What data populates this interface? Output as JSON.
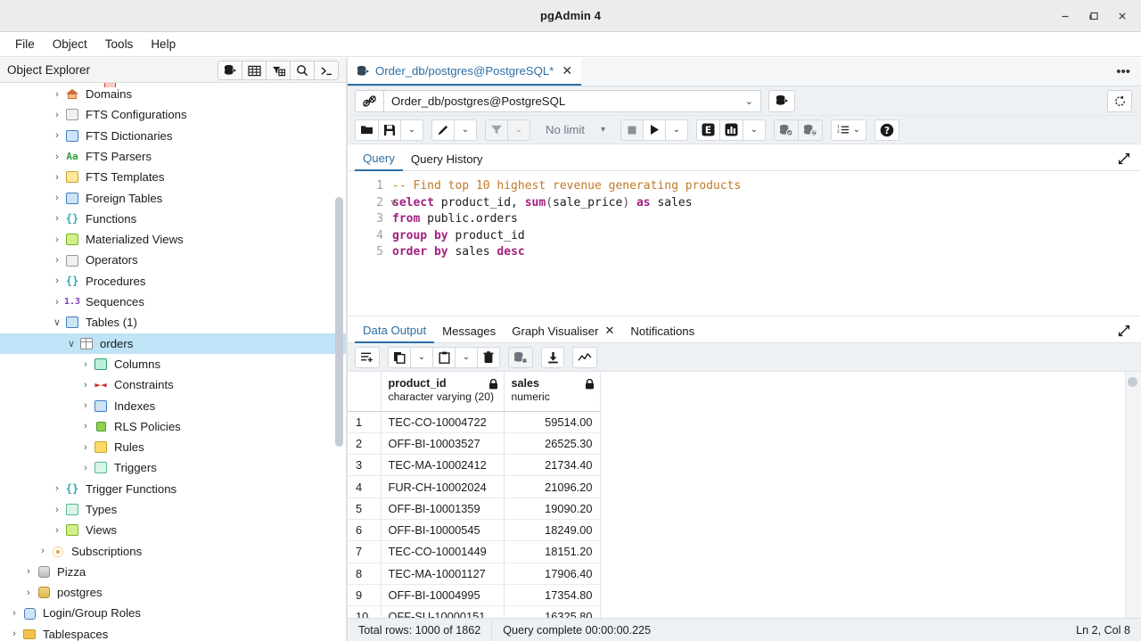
{
  "window": {
    "title": "pgAdmin 4",
    "minimize_label": "–",
    "maximize_label": "❐",
    "close_label": "✕"
  },
  "menubar": {
    "items": [
      {
        "label": "File"
      },
      {
        "label": "Object"
      },
      {
        "label": "Tools"
      },
      {
        "label": "Help"
      }
    ]
  },
  "object_explorer": {
    "title": "Object Explorer",
    "tools": [
      {
        "name": "server-connect-icon"
      },
      {
        "name": "grid-table-icon"
      },
      {
        "name": "filter-table-icon"
      },
      {
        "name": "search-icon"
      },
      {
        "name": "terminal-icon"
      }
    ],
    "tree": [
      {
        "label": "Domains",
        "indent": 5,
        "arrow": "›",
        "icon": "house"
      },
      {
        "label": "FTS Configurations",
        "indent": 5,
        "arrow": "›",
        "icon": "grayp"
      },
      {
        "label": "FTS Dictionaries",
        "indent": 5,
        "arrow": "›",
        "icon": "blue"
      },
      {
        "label": "FTS Parsers",
        "indent": 5,
        "arrow": "›",
        "icon": "aa"
      },
      {
        "label": "FTS Templates",
        "indent": 5,
        "arrow": "›",
        "icon": "yellow"
      },
      {
        "label": "Foreign Tables",
        "indent": 5,
        "arrow": "›",
        "icon": "blue"
      },
      {
        "label": "Functions",
        "indent": 5,
        "arrow": "›",
        "icon": "cyanring"
      },
      {
        "label": "Materialized Views",
        "indent": 5,
        "arrow": "›",
        "icon": "lime"
      },
      {
        "label": "Operators",
        "indent": 5,
        "arrow": "›",
        "icon": "grayp"
      },
      {
        "label": "Procedures",
        "indent": 5,
        "arrow": "›",
        "icon": "cyanring"
      },
      {
        "label": "Sequences",
        "indent": 5,
        "arrow": "›",
        "icon": "num13"
      },
      {
        "label": "Tables (1)",
        "indent": 5,
        "arrow": "∨",
        "icon": "blue"
      },
      {
        "label": "orders",
        "indent": 6,
        "arrow": "∨",
        "icon": "tablewhite",
        "selected": true
      },
      {
        "label": "Columns",
        "indent": 7,
        "arrow": "›",
        "icon": "green"
      },
      {
        "label": "Constraints",
        "indent": 7,
        "arrow": "›",
        "icon": "arrows"
      },
      {
        "label": "Indexes",
        "indent": 7,
        "arrow": "›",
        "icon": "blue"
      },
      {
        "label": "RLS Policies",
        "indent": 7,
        "arrow": "›",
        "icon": "lockg"
      },
      {
        "label": "Rules",
        "indent": 7,
        "arrow": "›",
        "icon": "yellow2"
      },
      {
        "label": "Triggers",
        "indent": 7,
        "arrow": "›",
        "icon": "greenlt"
      },
      {
        "label": "Trigger Functions",
        "indent": 5,
        "arrow": "›",
        "icon": "cyanring"
      },
      {
        "label": "Types",
        "indent": 5,
        "arrow": "›",
        "icon": "greenlt"
      },
      {
        "label": "Views",
        "indent": 5,
        "arrow": "›",
        "icon": "lime"
      },
      {
        "label": "Subscriptions",
        "indent": 4,
        "arrow": "›",
        "icon": "sub"
      },
      {
        "label": "Pizza",
        "indent": 3,
        "arrow": "›",
        "icon": "dbx"
      },
      {
        "label": "postgres",
        "indent": 3,
        "arrow": "›",
        "icon": "db"
      },
      {
        "label": "Login/Group Roles",
        "indent": 2,
        "arrow": "›",
        "icon": "roles"
      },
      {
        "label": "Tablespaces",
        "indent": 2,
        "arrow": "›",
        "icon": "folder"
      }
    ]
  },
  "query_tool": {
    "tab": {
      "label": "Order_db/postgres@PostgreSQL*",
      "close_label": "✕",
      "icon": "database-tab-icon"
    },
    "kebab_label": "more-options",
    "connection": {
      "value": "Order_db/postgres@PostgreSQL",
      "chevron": "⌄",
      "icon": "disconnect-icon",
      "new_connection_icon": "new-connection-icon",
      "reset_icon": "reset-layout-icon"
    },
    "toolbar": {
      "open_file": "folder-open-icon",
      "save_file": "save-icon",
      "save_chevron": "⌄",
      "edit": "pencil-icon",
      "edit_chevron": "⌄",
      "filter": "filter-icon",
      "filter_chevron": "⌄",
      "limit_label": "No limit",
      "limit_chevron": "▾",
      "stop": "stop-icon",
      "execute": "▶",
      "execute_chevron": "⌄",
      "explain": "E",
      "explain_analyze": "chart-bar-icon",
      "explain_chevron": "⌄",
      "commit": "commit-icon",
      "rollback": "rollback-icon",
      "macros": "macros-icon",
      "macros_chevron": "⌄",
      "help": "?"
    },
    "editor_tabs": [
      {
        "label": "Query",
        "active": true
      },
      {
        "label": "Query History",
        "active": false
      }
    ],
    "expand_icon": "↗",
    "sql": {
      "lines": [
        {
          "num": "1",
          "fold": ""
        },
        {
          "num": "2",
          "fold": "∨"
        },
        {
          "num": "3",
          "fold": ""
        },
        {
          "num": "4",
          "fold": ""
        },
        {
          "num": "5",
          "fold": ""
        }
      ],
      "text": [
        "-- Find top 10 highest revenue generating products",
        "select product_id, sum(sale_price) as sales",
        "from public.orders",
        "group by product_id",
        "order by sales desc"
      ]
    }
  },
  "output": {
    "tabs": [
      {
        "label": "Data Output",
        "active": true,
        "closable": false
      },
      {
        "label": "Messages",
        "active": false,
        "closable": false
      },
      {
        "label": "Graph Visualiser",
        "active": false,
        "closable": true,
        "close_label": "✕"
      },
      {
        "label": "Notifications",
        "active": false,
        "closable": false
      }
    ],
    "expand_icon": "↗",
    "toolbar": {
      "add_row": "add-row-icon",
      "copy": "copy-icon",
      "copy_chevron": "⌄",
      "paste": "paste-icon",
      "paste_chevron": "⌄",
      "delete": "trash-icon",
      "save_data": "save-data-icon",
      "download": "download-icon",
      "graph": "graph-icon"
    },
    "grid": {
      "columns": [
        {
          "name": "product_id",
          "type": "character varying (20)",
          "lock": "🔒"
        },
        {
          "name": "sales",
          "type": "numeric",
          "lock": "🔒"
        }
      ],
      "rows": [
        {
          "n": "1",
          "product_id": "TEC-CO-10004722",
          "sales": "59514.00"
        },
        {
          "n": "2",
          "product_id": "OFF-BI-10003527",
          "sales": "26525.30"
        },
        {
          "n": "3",
          "product_id": "TEC-MA-10002412",
          "sales": "21734.40"
        },
        {
          "n": "4",
          "product_id": "FUR-CH-10002024",
          "sales": "21096.20"
        },
        {
          "n": "5",
          "product_id": "OFF-BI-10001359",
          "sales": "19090.20"
        },
        {
          "n": "6",
          "product_id": "OFF-BI-10000545",
          "sales": "18249.00"
        },
        {
          "n": "7",
          "product_id": "TEC-CO-10001449",
          "sales": "18151.20"
        },
        {
          "n": "8",
          "product_id": "TEC-MA-10001127",
          "sales": "17906.40"
        },
        {
          "n": "9",
          "product_id": "OFF-BI-10004995",
          "sales": "17354.80"
        },
        {
          "n": "10",
          "product_id": "OFF-SU-10000151",
          "sales": "16325.80"
        }
      ]
    }
  },
  "statusbar": {
    "total_rows": "Total rows: 1000 of 1862",
    "query_status": "Query complete 00:00:00.225",
    "cursor_position": "Ln 2, Col 8"
  },
  "colors": {
    "accent": "#2c6ea5",
    "selection": "#bfe3f7",
    "keyword": "#a3207f",
    "comment": "#c07a28",
    "toolbar_bg": "#eef1f4"
  }
}
